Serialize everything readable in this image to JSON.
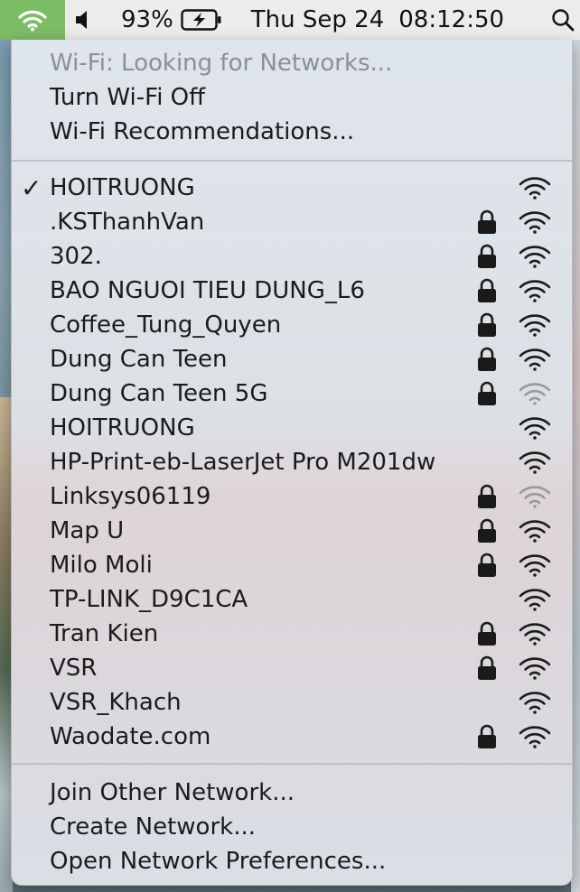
{
  "menubar": {
    "battery_pct": "93%",
    "date": "Thu Sep 24",
    "time": "08:12:50"
  },
  "menu": {
    "status": "Wi-Fi: Looking for Networks...",
    "toggle": "Turn Wi-Fi Off",
    "recommendations": "Wi-Fi Recommendations...",
    "networks": [
      {
        "name": "HOITRUONG",
        "checked": true,
        "locked": false,
        "signal": "strong"
      },
      {
        "name": ".KSThanhVan",
        "checked": false,
        "locked": true,
        "signal": "strong"
      },
      {
        "name": "302.",
        "checked": false,
        "locked": true,
        "signal": "strong"
      },
      {
        "name": "BAO NGUOI TIEU DUNG_L6",
        "checked": false,
        "locked": true,
        "signal": "strong"
      },
      {
        "name": "Coffee_Tung_Quyen",
        "checked": false,
        "locked": true,
        "signal": "strong"
      },
      {
        "name": "Dung Can Teen",
        "checked": false,
        "locked": true,
        "signal": "strong"
      },
      {
        "name": "Dung Can Teen 5G",
        "checked": false,
        "locked": true,
        "signal": "weak"
      },
      {
        "name": "HOITRUONG",
        "checked": false,
        "locked": false,
        "signal": "strong"
      },
      {
        "name": "HP-Print-eb-LaserJet Pro M201dw",
        "checked": false,
        "locked": false,
        "signal": "strong"
      },
      {
        "name": "Linksys06119",
        "checked": false,
        "locked": true,
        "signal": "weak"
      },
      {
        "name": "Map U",
        "checked": false,
        "locked": true,
        "signal": "strong"
      },
      {
        "name": "Milo Moli",
        "checked": false,
        "locked": true,
        "signal": "strong"
      },
      {
        "name": "TP-LINK_D9C1CA",
        "checked": false,
        "locked": false,
        "signal": "strong"
      },
      {
        "name": "Tran Kien",
        "checked": false,
        "locked": true,
        "signal": "strong"
      },
      {
        "name": "VSR",
        "checked": false,
        "locked": true,
        "signal": "strong"
      },
      {
        "name": "VSR_Khach",
        "checked": false,
        "locked": false,
        "signal": "strong"
      },
      {
        "name": "Waodate.com",
        "checked": false,
        "locked": true,
        "signal": "strong"
      }
    ],
    "join_other": "Join Other Network...",
    "create": "Create Network...",
    "preferences": "Open Network Preferences..."
  },
  "colors": {
    "wifi_active_bg": "#7cbc64",
    "menubar_bg": "#ececec"
  }
}
